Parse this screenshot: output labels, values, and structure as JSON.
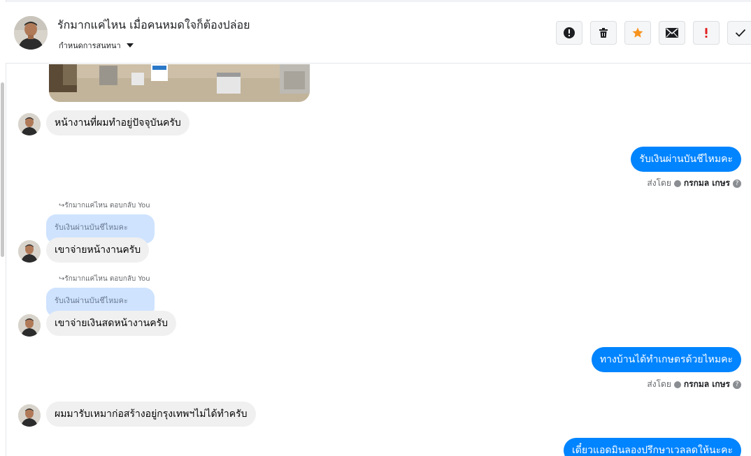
{
  "header": {
    "contact_name": "รักมากแค่ไหน เมื่อคนหมดใจก็ต้องปล่อย",
    "subtitle": "กำหนดการสนทนา",
    "actions": [
      {
        "name": "report",
        "icon": "exclamation-circle-icon"
      },
      {
        "name": "delete",
        "icon": "trash-icon"
      },
      {
        "name": "star",
        "icon": "star-icon"
      },
      {
        "name": "mail",
        "icon": "envelope-icon"
      },
      {
        "name": "important",
        "icon": "exclamation-icon"
      },
      {
        "name": "done",
        "icon": "check-icon"
      }
    ]
  },
  "messages": {
    "m1": {
      "text": "หน้างานที่ผมทำอยู่ปัจจุบันครับ"
    },
    "m2": {
      "text": "รับเงินผ่านบันชีไหมคะ",
      "sent_by_label": "ส่งโดย",
      "sent_by_name": "กรกมล เกษร"
    },
    "m3": {
      "reply_header": "รักมากแค่ไหน ตอบกลับ You",
      "quoted": "รับเงินผ่านบันชีไหมคะ",
      "text": "เขาจ่ายหน้างานครับ"
    },
    "m4": {
      "reply_header": "รักมากแค่ไหน ตอบกลับ You",
      "quoted": "รับเงินผ่านบันชีไหมคะ",
      "text": "เขาจ่ายเงินสดหน้างานครับ"
    },
    "m5": {
      "text": "ทางบ้านได้ทำเกษตรด้วยไหมคะ",
      "sent_by_label": "ส่งโดย",
      "sent_by_name": "กรกมล เกษร"
    },
    "m6": {
      "text": "ผมมารับเหมาก่อสร้างอยู่กรุงเทพฯไม่ได้ทำครับ"
    },
    "m7": {
      "text": "เดี๋ยวแอดมินลองปรึกษาเวลลดให้นะคะ"
    }
  },
  "colors": {
    "outgoing_bubble": "#0084ff",
    "incoming_bubble": "#f0f0f0",
    "quoted_bubble": "#cfe3ff",
    "star": "#f7931e",
    "important": "#e02020"
  }
}
